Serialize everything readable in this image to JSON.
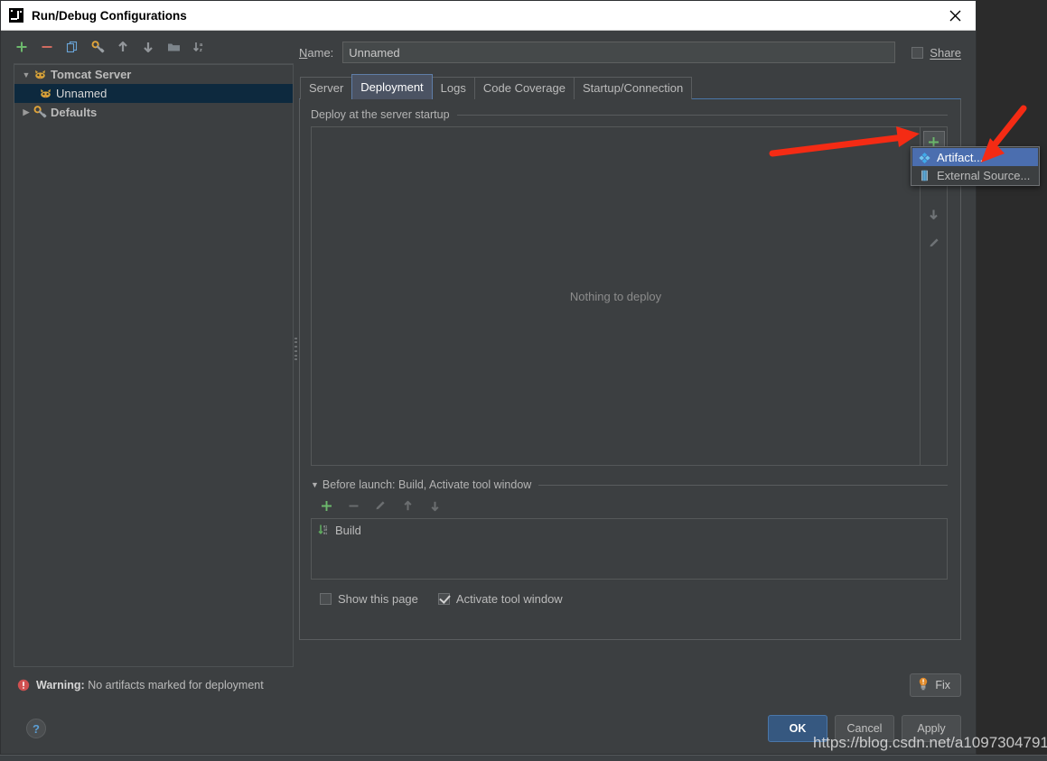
{
  "window": {
    "title": "Run/Debug Configurations",
    "close_label": "×",
    "app_icon": "intellij-idea-icon"
  },
  "left_panel": {
    "toolbar": [
      {
        "name": "add-configuration-button",
        "icon": "plus-icon",
        "color": "#4caf50"
      },
      {
        "name": "remove-configuration-button",
        "icon": "minus-icon",
        "color": "#d9756b"
      },
      {
        "name": "copy-configuration-button",
        "icon": "copy-icon",
        "color": "#5b9ed4"
      },
      {
        "name": "edit-defaults-button",
        "icon": "wrench-icon",
        "color": "#e8a33d"
      },
      {
        "name": "move-up-button",
        "icon": "arrow-up-icon",
        "color": "#9a9da0"
      },
      {
        "name": "move-down-button",
        "icon": "arrow-down-icon",
        "color": "#9a9da0"
      },
      {
        "name": "move-into-folder-button",
        "icon": "folder-icon",
        "color": "#7f858a"
      },
      {
        "name": "sort-alphabetically-button",
        "icon": "sort-az-icon",
        "color": "#9a9da0"
      }
    ],
    "tree": [
      {
        "label": "Tomcat Server",
        "icon": "tomcat-icon",
        "type": "group",
        "expanded": true,
        "selected": false
      },
      {
        "label": "Unnamed",
        "icon": "tomcat-icon",
        "type": "child",
        "expanded": false,
        "selected": true
      },
      {
        "label": "Defaults",
        "icon": "wrench-icon",
        "type": "group",
        "expanded": false,
        "selected": false
      }
    ]
  },
  "config": {
    "name_label": "Name:",
    "name_value": "Unnamed",
    "share_label": "Share",
    "share_checked": false,
    "tabs": [
      {
        "label": "Server",
        "active": false
      },
      {
        "label": "Deployment",
        "active": true
      },
      {
        "label": "Logs",
        "active": false
      },
      {
        "label": "Code Coverage",
        "active": false
      },
      {
        "label": "Startup/Connection",
        "active": false
      }
    ]
  },
  "deployment": {
    "section_title": "Deploy at the server startup",
    "empty_message": "Nothing to deploy",
    "side_toolbar": [
      {
        "name": "add-artifact-button",
        "icon": "plus-icon",
        "pressed": true
      },
      {
        "name": "move-down-button",
        "icon": "arrow-down-icon",
        "pressed": false
      },
      {
        "name": "edit-button",
        "icon": "pencil-icon",
        "pressed": false
      }
    ],
    "popup_menu": [
      {
        "label": "Artifact...",
        "icon": "artifact-icon",
        "selected": true
      },
      {
        "label": "External Source...",
        "icon": "external-source-icon",
        "selected": false
      }
    ]
  },
  "before_launch": {
    "title_prefix": "B",
    "title": "Before launch: Build, Activate tool window",
    "toolbar": [
      {
        "name": "add-task-button",
        "icon": "plus-icon",
        "enabled": true
      },
      {
        "name": "remove-task-button",
        "icon": "minus-icon",
        "enabled": false
      },
      {
        "name": "edit-task-button",
        "icon": "pencil-icon",
        "enabled": false
      },
      {
        "name": "move-task-up-button",
        "icon": "arrow-up-icon",
        "enabled": false
      },
      {
        "name": "move-task-down-button",
        "icon": "arrow-down-icon",
        "enabled": false
      }
    ],
    "tasks": [
      {
        "label": "Build",
        "icon": "build-icon"
      }
    ],
    "checkboxes": [
      {
        "label": "Show this page",
        "checked": false
      },
      {
        "label": "Activate tool window",
        "checked": true
      }
    ]
  },
  "warning": {
    "prefix": "Warning:",
    "message": "No artifacts marked for deployment",
    "fix_label": "Fix",
    "icon": "error-circle-icon",
    "fix_icon": "lightbulb-icon",
    "color": "#d9534f"
  },
  "footer": {
    "help_label": "?",
    "buttons": [
      {
        "label": "OK",
        "default": true
      },
      {
        "label": "Cancel",
        "default": false
      },
      {
        "label": "Apply",
        "default": false
      }
    ]
  },
  "watermark": {
    "text": "https://blog.csdn.net/a1097304791"
  },
  "theme": {
    "accent": "#4b6eaf",
    "window_bg": "#3c3f41",
    "selection_bg": "#0d293e",
    "default_button": "#365880",
    "annotation_red": "#f02020"
  }
}
